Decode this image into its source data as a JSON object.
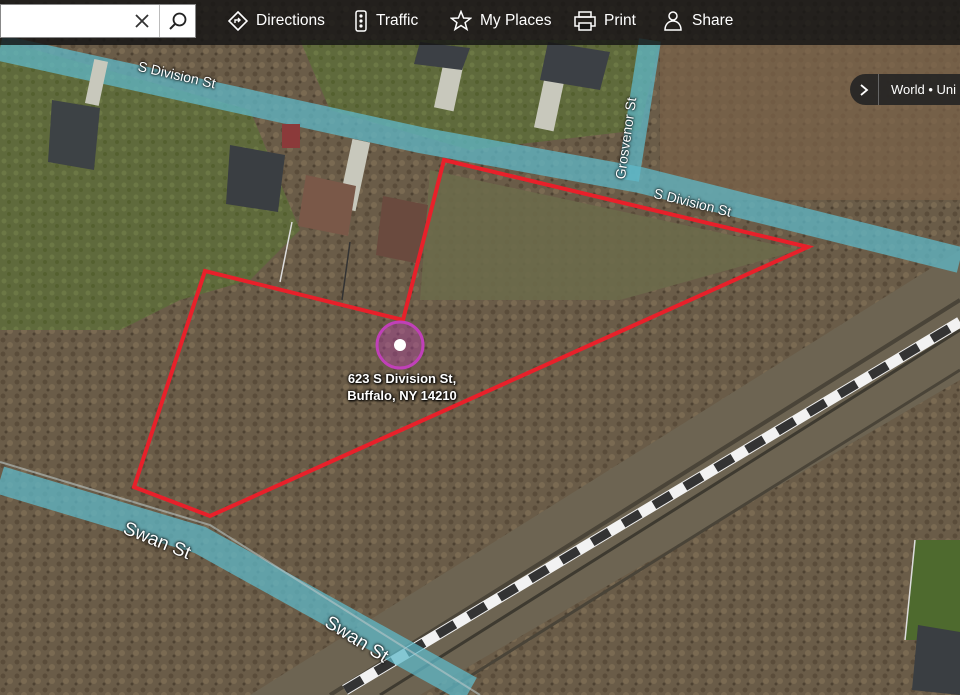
{
  "search": {
    "value": "",
    "placeholder": ""
  },
  "toolbar": {
    "directions_label": "Directions",
    "traffic_label": "Traffic",
    "my_places_label": "My Places",
    "print_label": "Print",
    "share_label": "Share"
  },
  "layers": {
    "label": "World • Uni"
  },
  "streets": {
    "division_upper": "S Division St",
    "grosvenor": "Grosvenor St",
    "division_right": "S Division St",
    "swan_upper": "Swan St",
    "swan_lower": "Swan St"
  },
  "pin": {
    "line1": "623 S Division St,",
    "line2": "Buffalo, NY 14210"
  },
  "colors": {
    "boundary": "#e8202a",
    "pin_ring": "#c040b8",
    "road_overlay": "#5fb8c8",
    "toolbar_bg": "#141414"
  }
}
